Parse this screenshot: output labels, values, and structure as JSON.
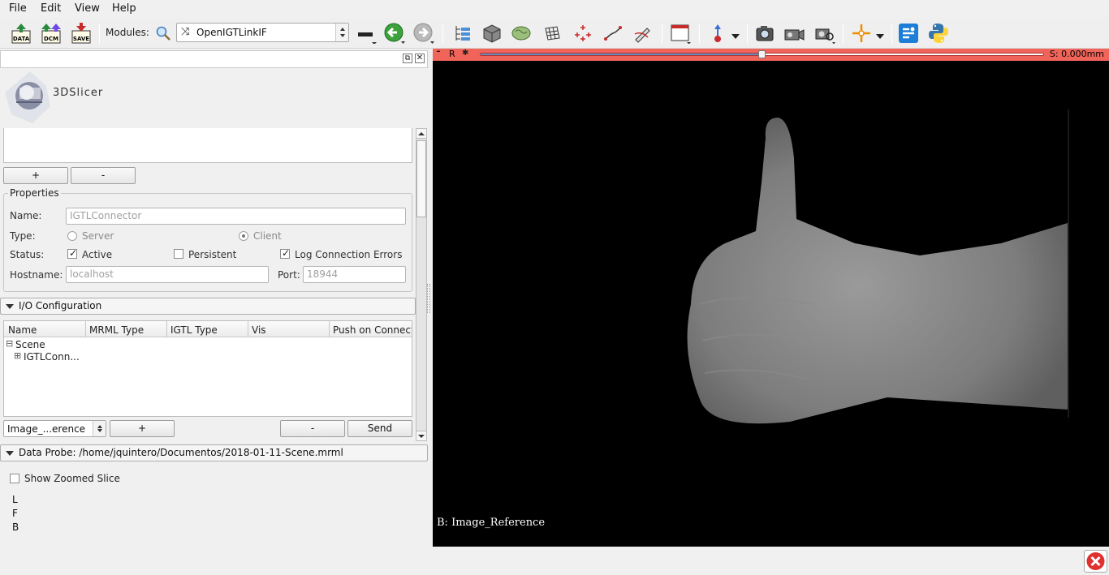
{
  "menubar": {
    "items": [
      "File",
      "Edit",
      "View",
      "Help"
    ]
  },
  "toolbar": {
    "data_label": "DATA",
    "dcm_label": "DCM",
    "save_label": "SAVE",
    "modules_label": "Modules:",
    "module_selected": "OpenIGTLinkIF"
  },
  "panel": {
    "logo_text": "3DSlicer",
    "add_label": "+",
    "remove_label": "-",
    "properties": {
      "title": "Properties",
      "name_label": "Name:",
      "name_value": "IGTLConnector",
      "type_label": "Type:",
      "type_server": "Server",
      "type_client": "Client",
      "status_label": "Status:",
      "active_label": "Active",
      "persistent_label": "Persistent",
      "log_errors_label": "Log Connection Errors",
      "hostname_label": "Hostname:",
      "hostname_value": "localhost",
      "port_label": "Port:",
      "port_value": "18944"
    },
    "io": {
      "title": "I/O Configuration",
      "columns": [
        "Name",
        "MRML Type",
        "IGTL Type",
        "Vis",
        "Push on Connect"
      ],
      "tree": [
        {
          "label": "Scene",
          "toggle": "⊟"
        },
        {
          "label": "IGTLConn...",
          "toggle": "⊞"
        }
      ],
      "node_select": "Image_...erence",
      "add_label": "+",
      "remove_label": "-",
      "send_label": "Send"
    },
    "probe": {
      "title": "Data Probe: /home/jquintero/Documentos/2018-01-11-Scene.mrml",
      "show_zoomed": "Show Zoomed Slice",
      "coords": [
        "L",
        "F",
        "B"
      ]
    }
  },
  "view": {
    "orientation": "R",
    "slice_offset": "S: 0.000mm",
    "slider_fraction": 0.5,
    "background_label": "B: Image_Reference",
    "accent_color": "#f0645a"
  }
}
